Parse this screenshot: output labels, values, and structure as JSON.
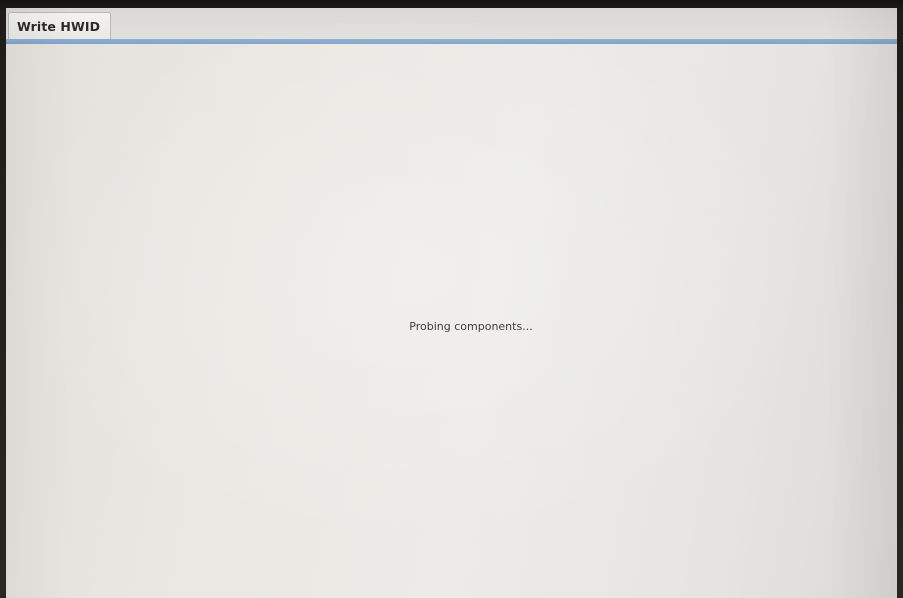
{
  "tabs": [
    {
      "label": "Write HWID",
      "active": true
    }
  ],
  "main": {
    "status_text": "Probing components..."
  },
  "colors": {
    "screen_background": "#ebe8e3",
    "tab_accent": "#7ea3c6",
    "text": "#3e3d3a"
  }
}
